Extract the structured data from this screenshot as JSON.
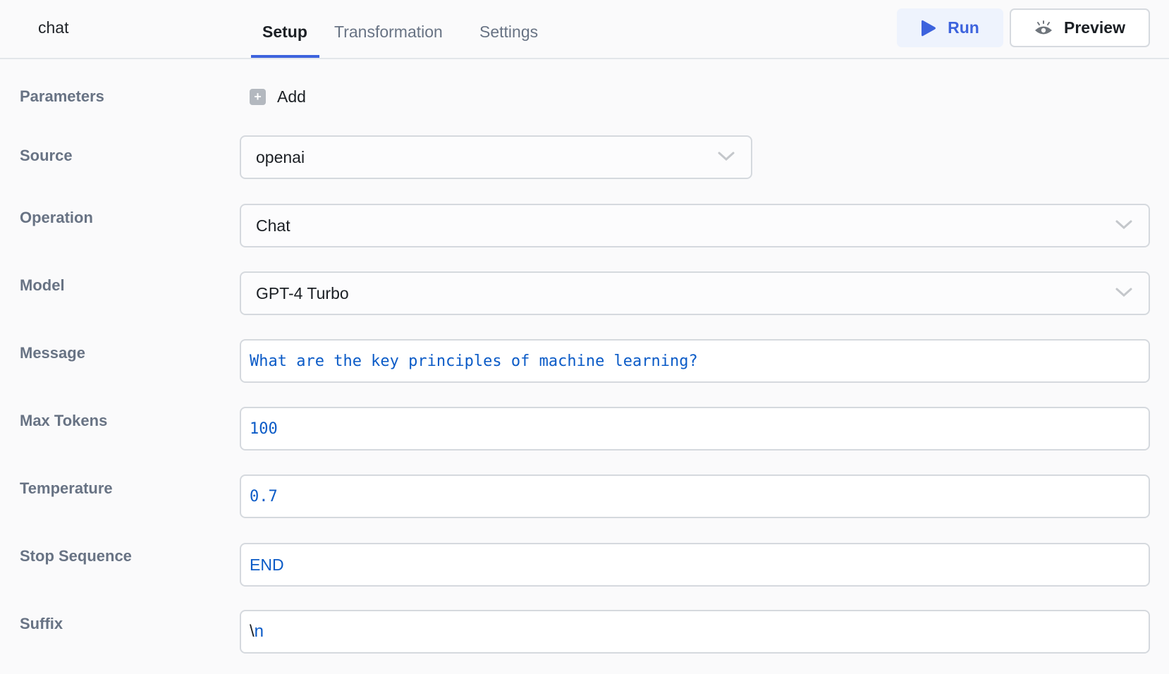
{
  "header": {
    "title": "chat",
    "tabs": [
      {
        "label": "Setup",
        "active": true
      },
      {
        "label": "Transformation",
        "active": false
      },
      {
        "label": "Settings",
        "active": false
      }
    ],
    "run_label": "Run",
    "preview_label": "Preview",
    "accent": "#3d63dd"
  },
  "form": {
    "parameters": {
      "label": "Parameters",
      "add_label": "Add"
    },
    "source": {
      "label": "Source",
      "value": "openai"
    },
    "operation": {
      "label": "Operation",
      "value": "Chat"
    },
    "model": {
      "label": "Model",
      "value": "GPT-4 Turbo"
    },
    "message": {
      "label": "Message",
      "value": "What are the key principles of machine learning?"
    },
    "max_tokens": {
      "label": "Max Tokens",
      "value": "100"
    },
    "temperature": {
      "label": "Temperature",
      "value": "0.7"
    },
    "stop_sequence": {
      "label": "Stop Sequence",
      "value": "END"
    },
    "suffix": {
      "label": "Suffix",
      "value_escape": "\\",
      "value_rest": "n"
    }
  }
}
